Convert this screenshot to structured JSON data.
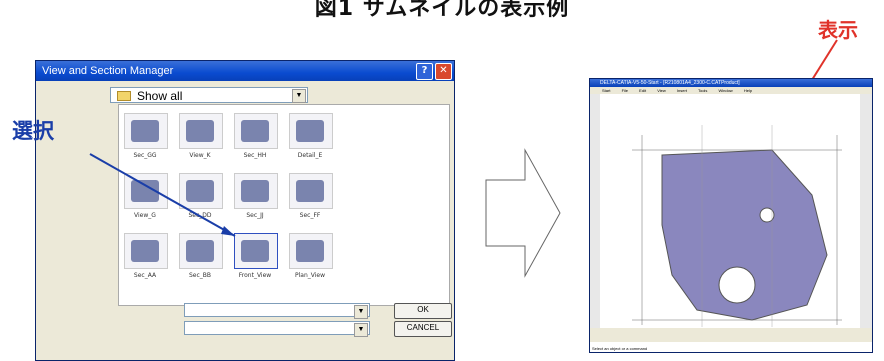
{
  "figure_title": "図1 サムネイルの表示例",
  "annotation_select": "選択",
  "annotation_display": "表示",
  "dialog": {
    "title": "View and Section Manager",
    "filter_value": "Show all",
    "views": [
      {
        "label": "Sec_GG"
      },
      {
        "label": "View_K"
      },
      {
        "label": "Sec_HH"
      },
      {
        "label": "Detail_E"
      },
      {
        "label": "View_G"
      },
      {
        "label": "Sec_DD"
      },
      {
        "label": "Sec_JJ"
      },
      {
        "label": "Sec_FF"
      },
      {
        "label": "Sec_AA"
      },
      {
        "label": "Sec_BB"
      },
      {
        "label": "Front_View"
      },
      {
        "label": "Plan_View"
      }
    ],
    "ok_label": "OK",
    "cancel_label": "CANCEL"
  },
  "app": {
    "title": "DELTA-CATIA-V5-50-Start - [R210801A4_2300-C.CATProduct]",
    "menu": [
      "Start",
      "File",
      "Edit",
      "View",
      "Insert",
      "Tools",
      "Window",
      "Help"
    ],
    "status": "Select an object or a command"
  }
}
